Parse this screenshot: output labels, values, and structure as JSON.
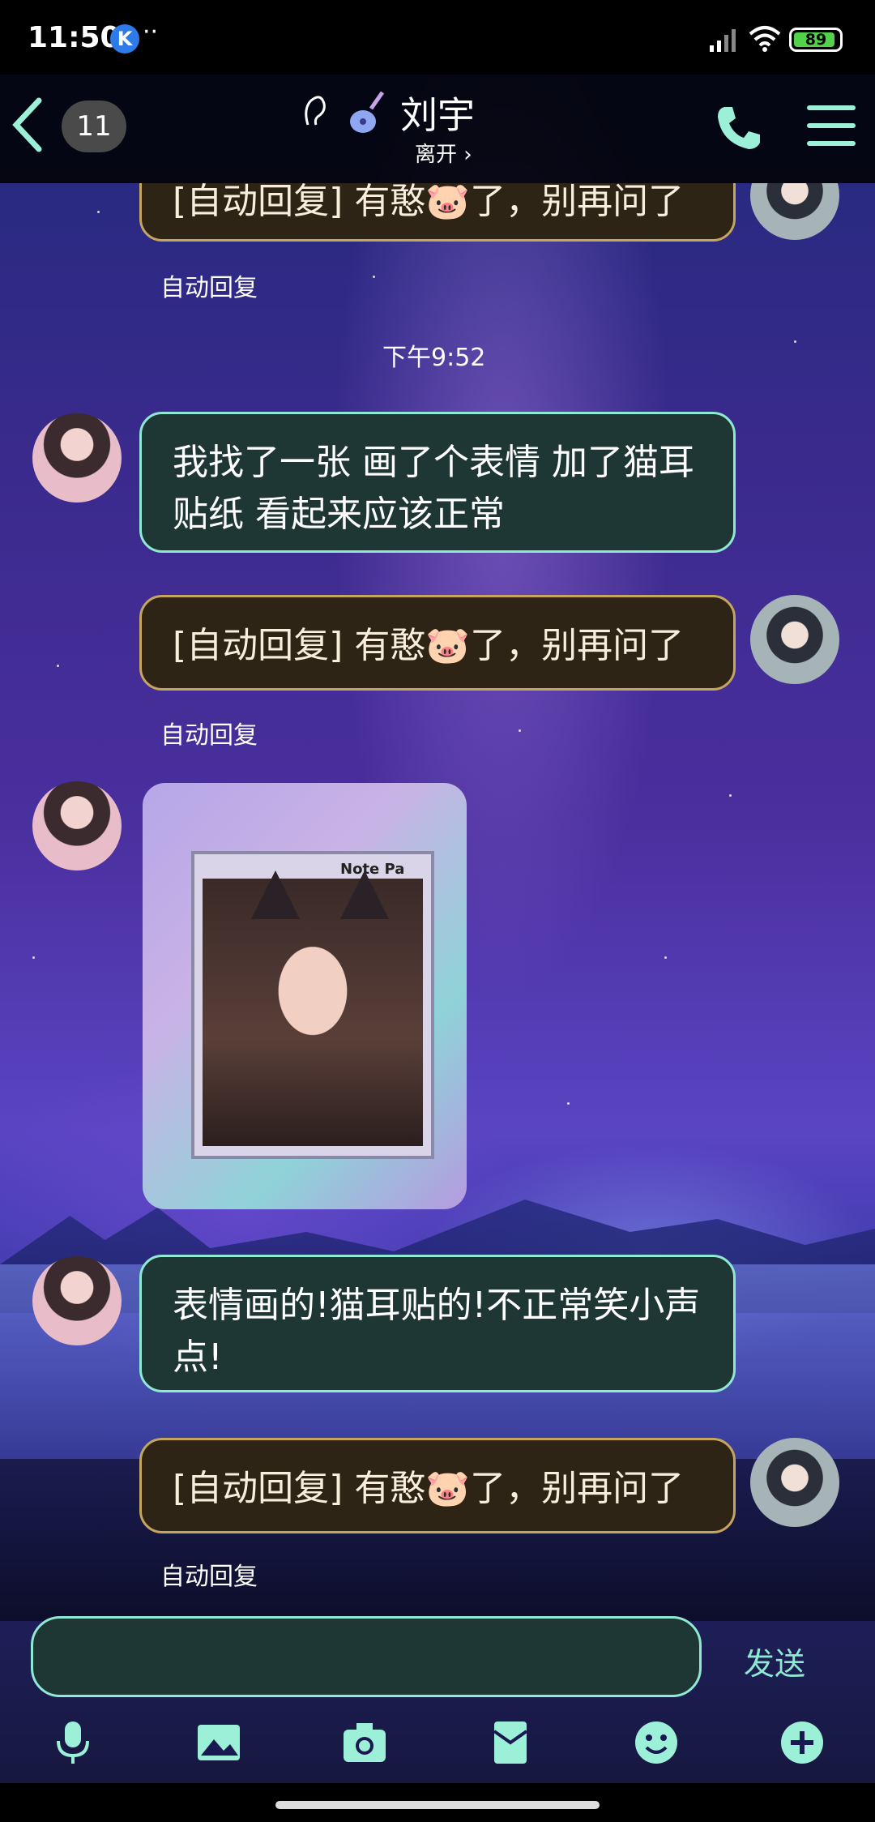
{
  "status_bar": {
    "time": "11:50",
    "app_badge": "K",
    "dots": "··",
    "battery": "89"
  },
  "header": {
    "unread_count": "11",
    "contact_name": "刘宇",
    "contact_status": "离开 ›"
  },
  "messages": [
    {
      "sender": "him",
      "text": "[自动回复] 有憨🐷了，别再问了",
      "sub_label": "自动回复"
    },
    {
      "type": "timestamp",
      "text": "下午9:52"
    },
    {
      "sender": "her",
      "text": "我找了一张 画了个表情 加了猫耳贴纸 看起来应该正常"
    },
    {
      "sender": "him",
      "text": "[自动回复] 有憨🐷了，别再问了",
      "sub_label": "自动回复"
    },
    {
      "sender": "her",
      "type": "image",
      "photo_title": "Note Pa"
    },
    {
      "sender": "her",
      "text": "表情画的!猫耳贴的!不正常笑小声点!"
    },
    {
      "sender": "him",
      "text": "[自动回复] 有憨🐷了，别再问了",
      "sub_label": "自动回复"
    }
  ],
  "composer": {
    "send_label": "发送",
    "toolbar_icons": [
      "microphone-icon",
      "image-icon",
      "camera-icon",
      "red-packet-icon",
      "emoji-icon",
      "plus-icon"
    ]
  },
  "colors": {
    "her_bubble_border": "#8fe8d2",
    "him_bubble_border": "#c4a65e",
    "accent": "#8fe8d2"
  }
}
